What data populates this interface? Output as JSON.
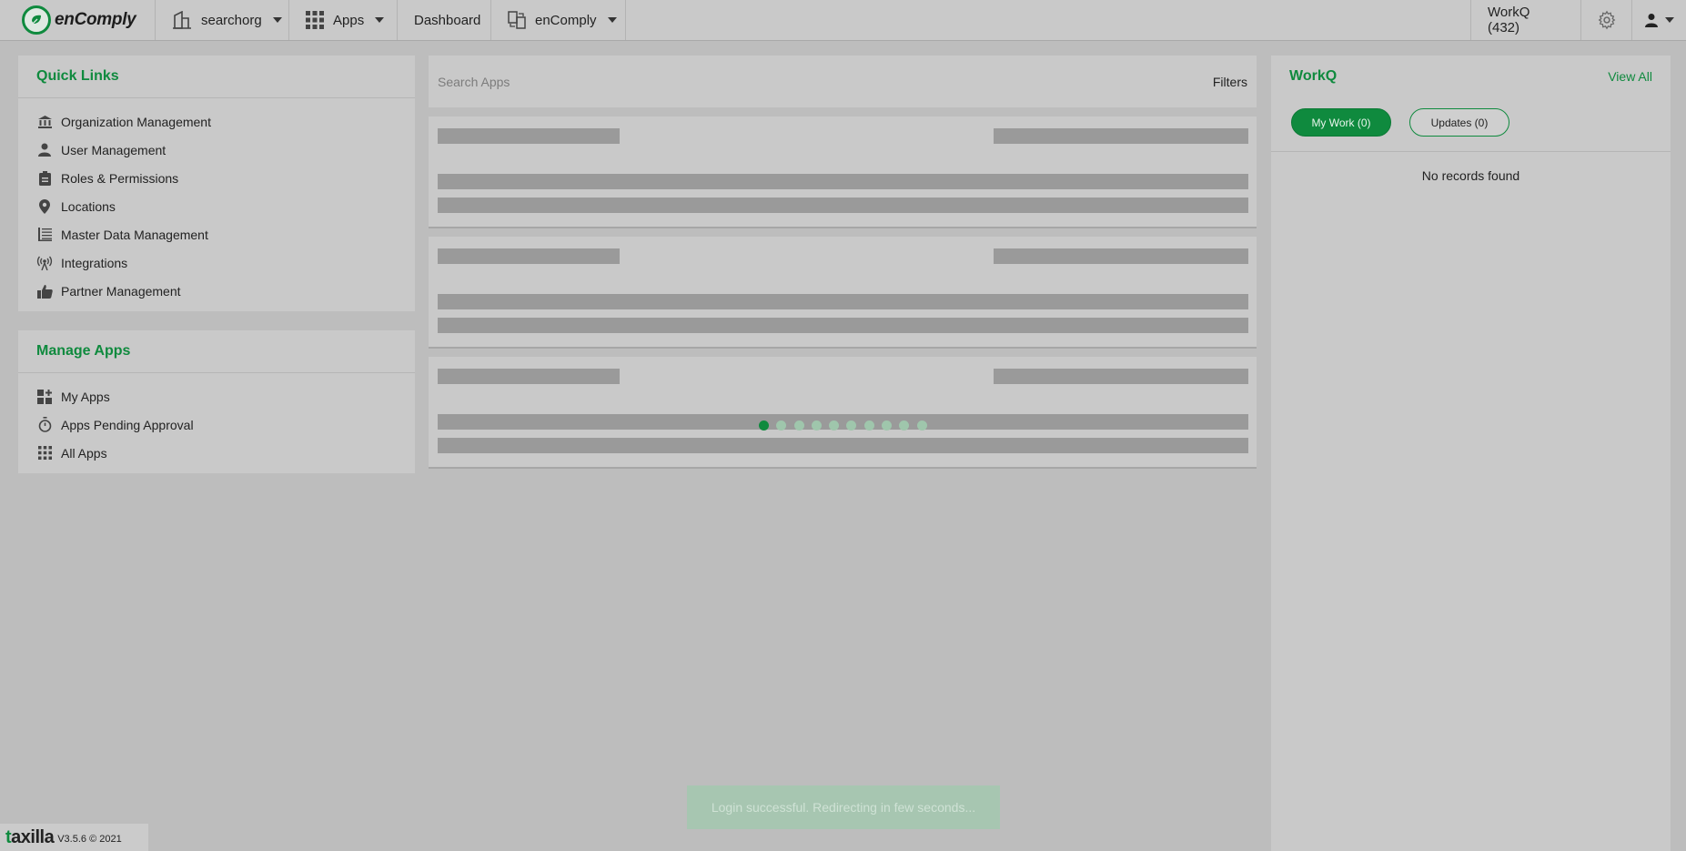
{
  "brand": {
    "name": "enComply",
    "accent": "#0f8a3e"
  },
  "topbar": {
    "org": "searchorg",
    "apps": "Apps",
    "dashboard": "Dashboard",
    "product": "enComply",
    "workq": "WorkQ (432)"
  },
  "quick_links": {
    "title": "Quick Links",
    "items": [
      {
        "label": "Organization Management",
        "icon": "bank-icon"
      },
      {
        "label": "User Management",
        "icon": "person-icon"
      },
      {
        "label": "Roles & Permissions",
        "icon": "clipboard-icon"
      },
      {
        "label": "Locations",
        "icon": "map-pin-icon"
      },
      {
        "label": "Master Data Management",
        "icon": "table-icon"
      },
      {
        "label": "Integrations",
        "icon": "broadcast-icon"
      },
      {
        "label": "Partner Management",
        "icon": "thumbs-up-icon"
      }
    ]
  },
  "manage_apps": {
    "title": "Manage Apps",
    "items": [
      {
        "label": "My Apps",
        "icon": "apps-grid-plus-icon"
      },
      {
        "label": "Apps Pending Approval",
        "icon": "stopwatch-icon"
      },
      {
        "label": "All Apps",
        "icon": "grid-icon"
      }
    ]
  },
  "search": {
    "placeholder": "Search Apps",
    "filters_label": "Filters"
  },
  "workq_panel": {
    "title": "WorkQ",
    "view_all": "View All",
    "tabs": [
      {
        "label": "My Work (0)",
        "active": true
      },
      {
        "label": "Updates (0)",
        "active": false
      }
    ],
    "empty_text": "No records found"
  },
  "toast": "Login successful. Redirecting in few seconds...",
  "footer": {
    "brand": "taxilla",
    "version": "V3.5.6 © 2021"
  }
}
